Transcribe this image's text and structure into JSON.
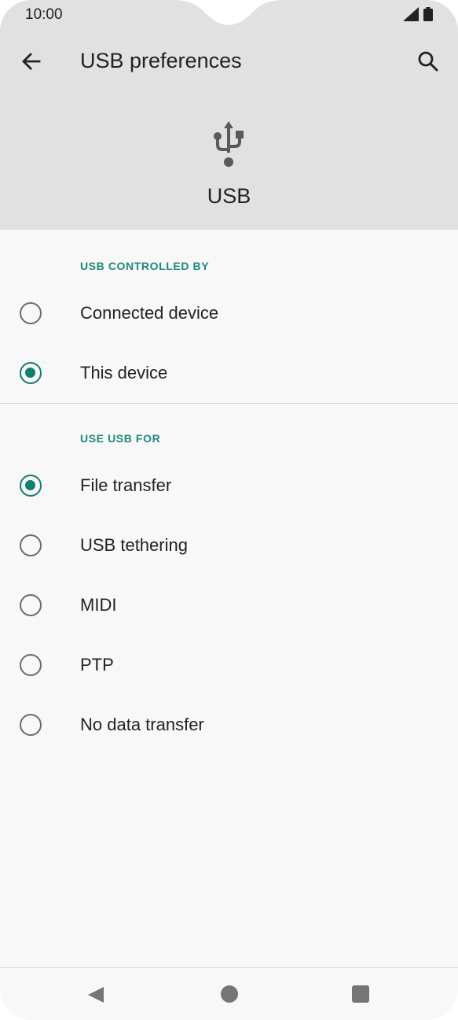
{
  "status_bar": {
    "time": "10:00",
    "icons": [
      "signal-icon",
      "battery-icon"
    ]
  },
  "app_bar": {
    "title": "USB preferences",
    "back_icon": "arrow-back-icon",
    "search_icon": "search-icon"
  },
  "header": {
    "icon": "usb-icon",
    "label": "USB"
  },
  "sections": [
    {
      "title": "USB CONTROLLED BY",
      "options": [
        {
          "label": "Connected device",
          "checked": false
        },
        {
          "label": "This device",
          "checked": true
        }
      ]
    },
    {
      "title": "USE USB FOR",
      "options": [
        {
          "label": "File transfer",
          "checked": true
        },
        {
          "label": "USB tethering",
          "checked": false
        },
        {
          "label": "MIDI",
          "checked": false
        },
        {
          "label": "PTP",
          "checked": false
        },
        {
          "label": "No data transfer",
          "checked": false
        }
      ]
    }
  ],
  "nav_bar": {
    "icons": [
      "nav-back-icon",
      "nav-home-icon",
      "nav-recents-icon"
    ]
  },
  "colors": {
    "accent": "#0f7f73",
    "header_bg": "#e1e1e1",
    "page_bg": "#f8f8f8"
  }
}
